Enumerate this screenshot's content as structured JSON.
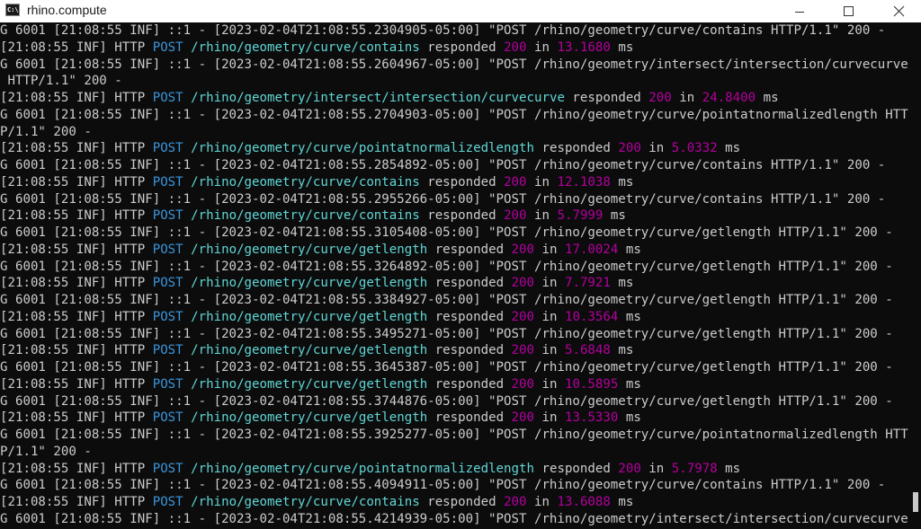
{
  "window": {
    "title": "rhino.compute",
    "icon_text": "C:\\"
  },
  "colors": {
    "console_bg": "#0c0c0c",
    "text": "#cccccc",
    "method": "#3a96dd",
    "url": "#61d6d6",
    "number": "#b4009e"
  },
  "console": {
    "lines": [
      "G 6001 [21:08:55 INF] ::1 - [2023-02-04T21:08:55.2304905-05:00] \"POST /rhino/geometry/curve/contains HTTP/1.1\" 200 -",
      "[21:08:55 INF] HTTP POST /rhino/geometry/curve/contains responded 200 in 13.1680 ms",
      "G 6001 [21:08:55 INF] ::1 - [2023-02-04T21:08:55.2604967-05:00] \"POST /rhino/geometry/intersect/intersection/curvecurve",
      " HTTP/1.1\" 200 -",
      "[21:08:55 INF] HTTP POST /rhino/geometry/intersect/intersection/curvecurve responded 200 in 24.8400 ms",
      "G 6001 [21:08:55 INF] ::1 - [2023-02-04T21:08:55.2704903-05:00] \"POST /rhino/geometry/curve/pointatnormalizedlength HTT",
      "P/1.1\" 200 -",
      "[21:08:55 INF] HTTP POST /rhino/geometry/curve/pointatnormalizedlength responded 200 in 5.0332 ms",
      "G 6001 [21:08:55 INF] ::1 - [2023-02-04T21:08:55.2854892-05:00] \"POST /rhino/geometry/curve/contains HTTP/1.1\" 200 -",
      "[21:08:55 INF] HTTP POST /rhino/geometry/curve/contains responded 200 in 12.1038 ms",
      "G 6001 [21:08:55 INF] ::1 - [2023-02-04T21:08:55.2955266-05:00] \"POST /rhino/geometry/curve/contains HTTP/1.1\" 200 -",
      "[21:08:55 INF] HTTP POST /rhino/geometry/curve/contains responded 200 in 5.7999 ms",
      "G 6001 [21:08:55 INF] ::1 - [2023-02-04T21:08:55.3105408-05:00] \"POST /rhino/geometry/curve/getlength HTTP/1.1\" 200 -",
      "[21:08:55 INF] HTTP POST /rhino/geometry/curve/getlength responded 200 in 17.0024 ms",
      "G 6001 [21:08:55 INF] ::1 - [2023-02-04T21:08:55.3264892-05:00] \"POST /rhino/geometry/curve/getlength HTTP/1.1\" 200 -",
      "[21:08:55 INF] HTTP POST /rhino/geometry/curve/getlength responded 200 in 7.7921 ms",
      "G 6001 [21:08:55 INF] ::1 - [2023-02-04T21:08:55.3384927-05:00] \"POST /rhino/geometry/curve/getlength HTTP/1.1\" 200 -",
      "[21:08:55 INF] HTTP POST /rhino/geometry/curve/getlength responded 200 in 10.3564 ms",
      "G 6001 [21:08:55 INF] ::1 - [2023-02-04T21:08:55.3495271-05:00] \"POST /rhino/geometry/curve/getlength HTTP/1.1\" 200 -",
      "[21:08:55 INF] HTTP POST /rhino/geometry/curve/getlength responded 200 in 5.6848 ms",
      "G 6001 [21:08:55 INF] ::1 - [2023-02-04T21:08:55.3645387-05:00] \"POST /rhino/geometry/curve/getlength HTTP/1.1\" 200 -",
      "[21:08:55 INF] HTTP POST /rhino/geometry/curve/getlength responded 200 in 10.5895 ms",
      "G 6001 [21:08:55 INF] ::1 - [2023-02-04T21:08:55.3744876-05:00] \"POST /rhino/geometry/curve/getlength HTTP/1.1\" 200 -",
      "[21:08:55 INF] HTTP POST /rhino/geometry/curve/getlength responded 200 in 13.5330 ms",
      "G 6001 [21:08:55 INF] ::1 - [2023-02-04T21:08:55.3925277-05:00] \"POST /rhino/geometry/curve/pointatnormalizedlength HTT",
      "P/1.1\" 200 -",
      "[21:08:55 INF] HTTP POST /rhino/geometry/curve/pointatnormalizedlength responded 200 in 5.7978 ms",
      "G 6001 [21:08:55 INF] ::1 - [2023-02-04T21:08:55.4094911-05:00] \"POST /rhino/geometry/curve/contains HTTP/1.1\" 200 -",
      "[21:08:55 INF] HTTP POST /rhino/geometry/curve/contains responded 200 in 13.6088 ms",
      "G 6001 [21:08:55 INF] ::1 - [2023-02-04T21:08:55.4214939-05:00] \"POST /rhino/geometry/intersect/intersection/curvecurve"
    ]
  }
}
